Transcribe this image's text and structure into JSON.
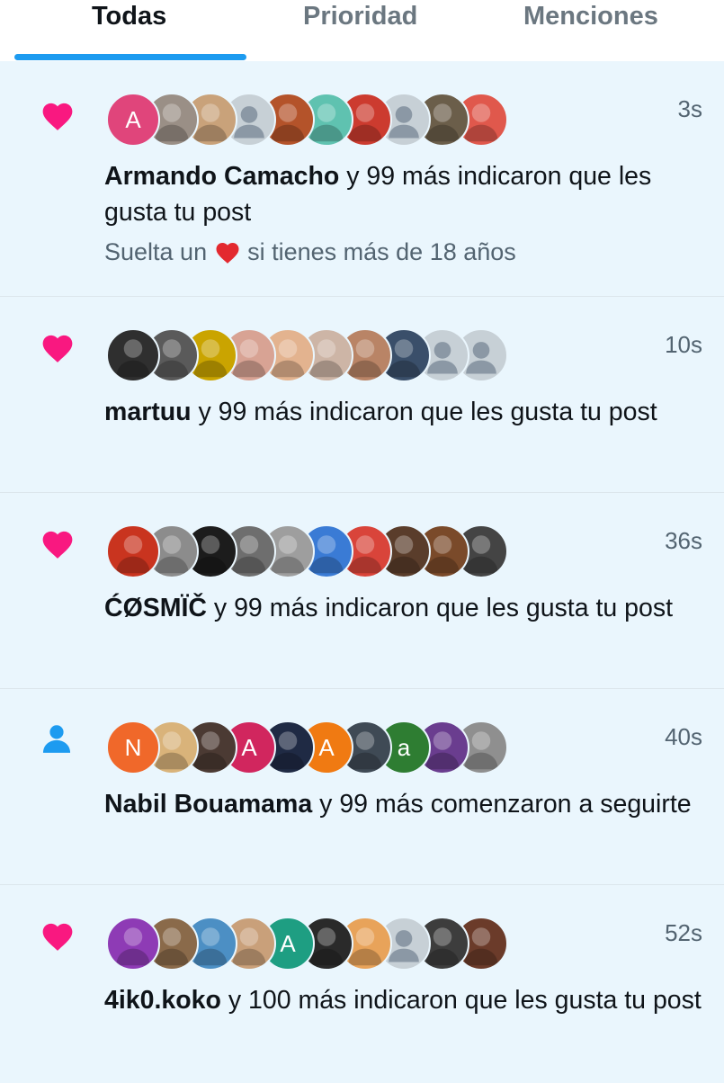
{
  "tabs": [
    {
      "label": "Todas",
      "active": true
    },
    {
      "label": "Prioridad",
      "active": false
    },
    {
      "label": "Menciones",
      "active": false
    }
  ],
  "colors": {
    "accent": "#1d9bf0",
    "like_pink": "#f91880",
    "follow_blue": "#1d9bf0",
    "background": "#eaf6fd"
  },
  "notifications": [
    {
      "type": "like",
      "icon": "heart-icon",
      "name": "Armando Camacho",
      "action": " y 99 más indicaron que les gusta tu post",
      "time": "3s",
      "sub_before": "Suelta un ",
      "sub_emoji": "red-heart-emoji",
      "sub_after": " si tienes más de 18 años",
      "avatars": [
        {
          "letter": "A",
          "color": "#e0457b"
        },
        {
          "letter": "",
          "color": "#9a8f86"
        },
        {
          "letter": "",
          "color": "#c9a27a"
        },
        {
          "letter": "",
          "color": "#c7d0d6",
          "default": true
        },
        {
          "letter": "",
          "color": "#b4532a"
        },
        {
          "letter": "",
          "color": "#5fc2b0"
        },
        {
          "letter": "",
          "color": "#cc3b2f"
        },
        {
          "letter": "",
          "color": "#c7d0d6",
          "default": true
        },
        {
          "letter": "",
          "color": "#6b5e4a"
        },
        {
          "letter": "",
          "color": "#e0584c"
        }
      ]
    },
    {
      "type": "like",
      "icon": "heart-icon",
      "name": "martuu",
      "action": " y 99 más indicaron que les gusta tu post",
      "time": "10s",
      "avatars": [
        {
          "letter": "",
          "color": "#2f2f2f"
        },
        {
          "letter": "",
          "color": "#5a5a5a"
        },
        {
          "letter": "",
          "color": "#caa400"
        },
        {
          "letter": "",
          "color": "#d8a394"
        },
        {
          "letter": "",
          "color": "#e3b38f"
        },
        {
          "letter": "",
          "color": "#cdb5a6"
        },
        {
          "letter": "",
          "color": "#b98466"
        },
        {
          "letter": "",
          "color": "#3a4f6a"
        },
        {
          "letter": "",
          "color": "#c7d0d6",
          "default": true
        },
        {
          "letter": "",
          "color": "#c7d0d6",
          "default": true
        }
      ]
    },
    {
      "type": "like",
      "icon": "heart-icon",
      "name": "ĆØSMÏČ",
      "action": " y 99 más indicaron que les gusta tu post",
      "time": "36s",
      "avatars": [
        {
          "letter": "",
          "color": "#c9341f"
        },
        {
          "letter": "",
          "color": "#8c8c8c"
        },
        {
          "letter": "",
          "color": "#1c1c1c"
        },
        {
          "letter": "",
          "color": "#6e6e6e"
        },
        {
          "letter": "",
          "color": "#9e9e9e"
        },
        {
          "letter": "",
          "color": "#3a7bd5"
        },
        {
          "letter": "",
          "color": "#d9443a"
        },
        {
          "letter": "",
          "color": "#5a3d2b"
        },
        {
          "letter": "",
          "color": "#7a4a2a"
        },
        {
          "letter": "",
          "color": "#444444"
        }
      ]
    },
    {
      "type": "follow",
      "icon": "person-icon",
      "name": "Nabil Bouamama",
      "action": " y 99 más comenzaron a seguirte",
      "time": "40s",
      "avatars": [
        {
          "letter": "N",
          "color": "#f0682a"
        },
        {
          "letter": "",
          "color": "#d9b37a"
        },
        {
          "letter": "",
          "color": "#4b3a33"
        },
        {
          "letter": "A",
          "color": "#d1265e"
        },
        {
          "letter": "",
          "color": "#1f2a44"
        },
        {
          "letter": "A",
          "color": "#f07a12"
        },
        {
          "letter": "",
          "color": "#3f4a55"
        },
        {
          "letter": "a",
          "color": "#2e7d32"
        },
        {
          "letter": "",
          "color": "#6a3d8f"
        },
        {
          "letter": "",
          "color": "#8f8f8f"
        }
      ]
    },
    {
      "type": "like",
      "icon": "heart-icon",
      "name": "4ik0.koko",
      "action": " y 100 más indicaron que les gusta tu post",
      "time": "52s",
      "avatars": [
        {
          "letter": "",
          "color": "#8e3bb5"
        },
        {
          "letter": "",
          "color": "#8a6a4a"
        },
        {
          "letter": "",
          "color": "#4c8fc4"
        },
        {
          "letter": "",
          "color": "#c9a07a"
        },
        {
          "letter": "A",
          "color": "#1e9e82"
        },
        {
          "letter": "",
          "color": "#2a2a2a"
        },
        {
          "letter": "",
          "color": "#e8a35a"
        },
        {
          "letter": "",
          "color": "#c7d0d6",
          "default": true
        },
        {
          "letter": "",
          "color": "#3d3d3d"
        },
        {
          "letter": "",
          "color": "#6b3b2a"
        }
      ]
    }
  ]
}
